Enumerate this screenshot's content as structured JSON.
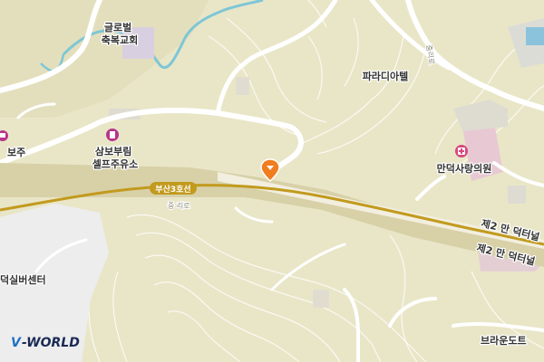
{
  "labels": {
    "church": "글로벌\n축복교회",
    "paradise": "파라디아텔",
    "hospital": "만덕사랑의원",
    "bojoo": "보주",
    "rest_area": "삼보부림\n셀프주유소",
    "tunnel_upper": "제2 만 덕터널",
    "tunnel_lower": "제2 만 덕터널",
    "silver_center": "덕실버센터",
    "brown": "브라운도트",
    "jungri_road_side": "중리로",
    "jungri_road_bottom": "중 리로",
    "route_sign": "부산3호선"
  },
  "logo": {
    "v": "V",
    "world": "-WORLD"
  },
  "colors": {
    "land": "#e9e6c8",
    "road": "#ffffff",
    "highway": "#d8d1a8",
    "route_line": "#c29a1e",
    "stream": "#7ec6d6",
    "contour": "#ffffff",
    "hospital_marker": "#d8477e",
    "pin": "#f07d1e",
    "logo_v": "#1c6fc7"
  },
  "icons": [
    "gas-station-icon",
    "hospital-icon",
    "location-pin-icon",
    "bus-icon"
  ]
}
